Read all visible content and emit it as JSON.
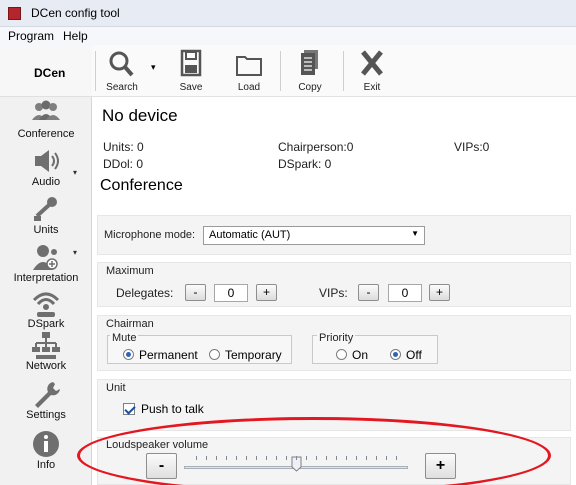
{
  "window": {
    "title": "DCen config tool"
  },
  "menu": [
    "Program",
    "Help"
  ],
  "sidebar": {
    "header": "DCen",
    "items": [
      {
        "label": "Conference",
        "icon": "people-icon"
      },
      {
        "label": "Audio",
        "icon": "speaker-icon"
      },
      {
        "label": "Units",
        "icon": "microphone-icon"
      },
      {
        "label": "Interpretation",
        "icon": "interpreter-icon"
      },
      {
        "label": "DSpark",
        "icon": "wireless-icon"
      },
      {
        "label": "Network",
        "icon": "network-icon"
      },
      {
        "label": "Settings",
        "icon": "wrench-icon"
      },
      {
        "label": "Info",
        "icon": "info-icon"
      }
    ]
  },
  "toolbar": {
    "search": "Search",
    "save": "Save",
    "load": "Load",
    "copy": "Copy",
    "exit": "Exit"
  },
  "device": {
    "title": "No device",
    "units": "Units: 0",
    "chairperson": "Chairperson:0",
    "vips": "VIPs:0",
    "ddol": "DDol: 0",
    "dspark": "DSpark: 0"
  },
  "conference": {
    "title": "Conference",
    "mic_mode_label": "Microphone mode:",
    "mic_mode_value": "Automatic (AUT)",
    "maximum": {
      "label": "Maximum",
      "delegates_label": "Delegates:",
      "delegates_value": "0",
      "vips_label": "VIPs:",
      "vips_value": "0",
      "minus": "-",
      "plus": "+"
    },
    "chairman": {
      "label": "Chairman",
      "mute_label": "Mute",
      "permanent": "Permanent",
      "temporary": "Temporary",
      "mute_selected": "Permanent",
      "priority_label": "Priority",
      "on": "On",
      "off": "Off",
      "priority_selected": "Off"
    },
    "unit": {
      "label": "Unit",
      "push_to_talk": "Push to talk",
      "push_to_talk_checked": true
    },
    "loudspeaker": {
      "label": "Loudspeaker volume",
      "minus": "-",
      "plus": "+",
      "level": 0.5
    }
  },
  "colors": {
    "accent": "#2f64b8",
    "highlight": "#e4161f",
    "titlebar": "#e7ecf4"
  }
}
